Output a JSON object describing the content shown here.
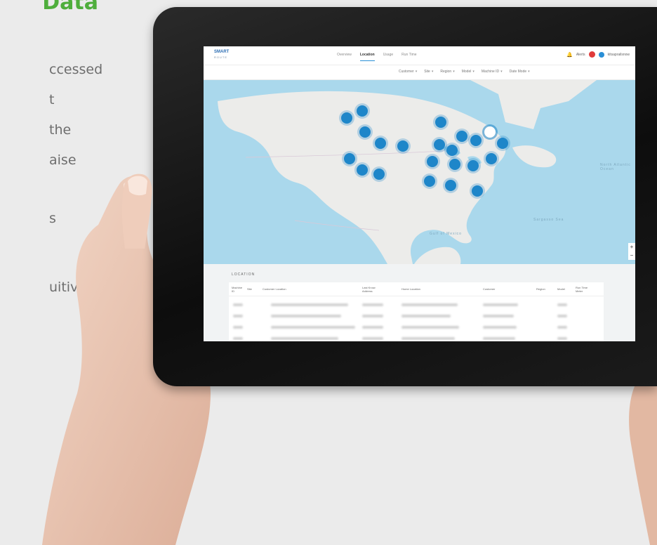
{
  "copy": {
    "title": "Data",
    "lines": [
      "ccessed",
      "t",
      "the",
      "aise",
      "s",
      "uitive"
    ]
  },
  "app": {
    "logo": "SMART",
    "logo_sub": "ROUTE",
    "tabs": [
      "Overview",
      "Location",
      "Usage",
      "Run Time"
    ],
    "active_tab": "Location",
    "header_right": {
      "alerts_label": "Alerts",
      "user_label": "kitsaprailsnow"
    },
    "filters": [
      "Customer",
      "Site",
      "Region",
      "Model",
      "Machine ID",
      "Date Mode"
    ]
  },
  "map": {
    "water_labels": [
      "North Atlantic Ocean",
      "Gulf of Mexico",
      "Sargasso Sea"
    ],
    "zoom_in": "+",
    "zoom_out": "−"
  },
  "table": {
    "section_title": "LOCATION",
    "columns": [
      "Machine ID",
      "Site",
      "Customer Location",
      "Last Know Address",
      "Home Location",
      "Customer",
      "Region",
      "Model",
      "Run Time Meter"
    ]
  },
  "colors": {
    "accent_green": "#4fae3c",
    "marker_blue": "#1e86c9",
    "water": "#aad8ec",
    "alert_red": "#e03b3b"
  }
}
